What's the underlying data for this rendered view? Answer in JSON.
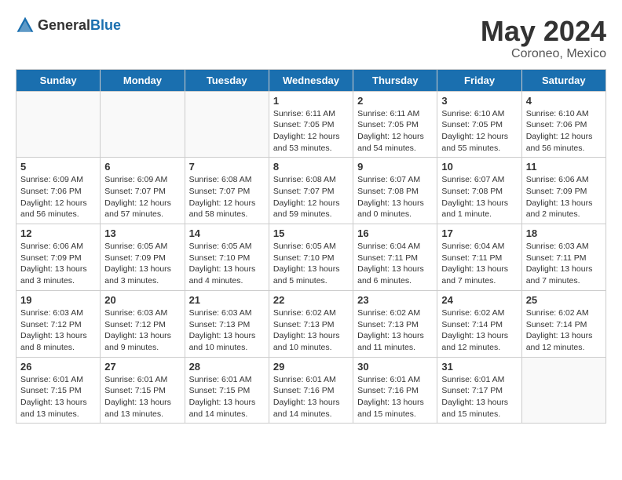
{
  "header": {
    "logo_general": "General",
    "logo_blue": "Blue",
    "month_year": "May 2024",
    "location": "Coroneo, Mexico"
  },
  "days_of_week": [
    "Sunday",
    "Monday",
    "Tuesday",
    "Wednesday",
    "Thursday",
    "Friday",
    "Saturday"
  ],
  "weeks": [
    [
      {
        "day": "",
        "info": "",
        "empty": true
      },
      {
        "day": "",
        "info": "",
        "empty": true
      },
      {
        "day": "",
        "info": "",
        "empty": true
      },
      {
        "day": "1",
        "info": "Sunrise: 6:11 AM\nSunset: 7:05 PM\nDaylight: 12 hours\nand 53 minutes."
      },
      {
        "day": "2",
        "info": "Sunrise: 6:11 AM\nSunset: 7:05 PM\nDaylight: 12 hours\nand 54 minutes."
      },
      {
        "day": "3",
        "info": "Sunrise: 6:10 AM\nSunset: 7:05 PM\nDaylight: 12 hours\nand 55 minutes."
      },
      {
        "day": "4",
        "info": "Sunrise: 6:10 AM\nSunset: 7:06 PM\nDaylight: 12 hours\nand 56 minutes."
      }
    ],
    [
      {
        "day": "5",
        "info": "Sunrise: 6:09 AM\nSunset: 7:06 PM\nDaylight: 12 hours\nand 56 minutes."
      },
      {
        "day": "6",
        "info": "Sunrise: 6:09 AM\nSunset: 7:07 PM\nDaylight: 12 hours\nand 57 minutes."
      },
      {
        "day": "7",
        "info": "Sunrise: 6:08 AM\nSunset: 7:07 PM\nDaylight: 12 hours\nand 58 minutes."
      },
      {
        "day": "8",
        "info": "Sunrise: 6:08 AM\nSunset: 7:07 PM\nDaylight: 12 hours\nand 59 minutes."
      },
      {
        "day": "9",
        "info": "Sunrise: 6:07 AM\nSunset: 7:08 PM\nDaylight: 13 hours\nand 0 minutes."
      },
      {
        "day": "10",
        "info": "Sunrise: 6:07 AM\nSunset: 7:08 PM\nDaylight: 13 hours\nand 1 minute."
      },
      {
        "day": "11",
        "info": "Sunrise: 6:06 AM\nSunset: 7:09 PM\nDaylight: 13 hours\nand 2 minutes."
      }
    ],
    [
      {
        "day": "12",
        "info": "Sunrise: 6:06 AM\nSunset: 7:09 PM\nDaylight: 13 hours\nand 3 minutes."
      },
      {
        "day": "13",
        "info": "Sunrise: 6:05 AM\nSunset: 7:09 PM\nDaylight: 13 hours\nand 3 minutes."
      },
      {
        "day": "14",
        "info": "Sunrise: 6:05 AM\nSunset: 7:10 PM\nDaylight: 13 hours\nand 4 minutes."
      },
      {
        "day": "15",
        "info": "Sunrise: 6:05 AM\nSunset: 7:10 PM\nDaylight: 13 hours\nand 5 minutes."
      },
      {
        "day": "16",
        "info": "Sunrise: 6:04 AM\nSunset: 7:11 PM\nDaylight: 13 hours\nand 6 minutes."
      },
      {
        "day": "17",
        "info": "Sunrise: 6:04 AM\nSunset: 7:11 PM\nDaylight: 13 hours\nand 7 minutes."
      },
      {
        "day": "18",
        "info": "Sunrise: 6:03 AM\nSunset: 7:11 PM\nDaylight: 13 hours\nand 7 minutes."
      }
    ],
    [
      {
        "day": "19",
        "info": "Sunrise: 6:03 AM\nSunset: 7:12 PM\nDaylight: 13 hours\nand 8 minutes."
      },
      {
        "day": "20",
        "info": "Sunrise: 6:03 AM\nSunset: 7:12 PM\nDaylight: 13 hours\nand 9 minutes."
      },
      {
        "day": "21",
        "info": "Sunrise: 6:03 AM\nSunset: 7:13 PM\nDaylight: 13 hours\nand 10 minutes."
      },
      {
        "day": "22",
        "info": "Sunrise: 6:02 AM\nSunset: 7:13 PM\nDaylight: 13 hours\nand 10 minutes."
      },
      {
        "day": "23",
        "info": "Sunrise: 6:02 AM\nSunset: 7:13 PM\nDaylight: 13 hours\nand 11 minutes."
      },
      {
        "day": "24",
        "info": "Sunrise: 6:02 AM\nSunset: 7:14 PM\nDaylight: 13 hours\nand 12 minutes."
      },
      {
        "day": "25",
        "info": "Sunrise: 6:02 AM\nSunset: 7:14 PM\nDaylight: 13 hours\nand 12 minutes."
      }
    ],
    [
      {
        "day": "26",
        "info": "Sunrise: 6:01 AM\nSunset: 7:15 PM\nDaylight: 13 hours\nand 13 minutes."
      },
      {
        "day": "27",
        "info": "Sunrise: 6:01 AM\nSunset: 7:15 PM\nDaylight: 13 hours\nand 13 minutes."
      },
      {
        "day": "28",
        "info": "Sunrise: 6:01 AM\nSunset: 7:15 PM\nDaylight: 13 hours\nand 14 minutes."
      },
      {
        "day": "29",
        "info": "Sunrise: 6:01 AM\nSunset: 7:16 PM\nDaylight: 13 hours\nand 14 minutes."
      },
      {
        "day": "30",
        "info": "Sunrise: 6:01 AM\nSunset: 7:16 PM\nDaylight: 13 hours\nand 15 minutes."
      },
      {
        "day": "31",
        "info": "Sunrise: 6:01 AM\nSunset: 7:17 PM\nDaylight: 13 hours\nand 15 minutes."
      },
      {
        "day": "",
        "info": "",
        "empty": true
      }
    ]
  ]
}
